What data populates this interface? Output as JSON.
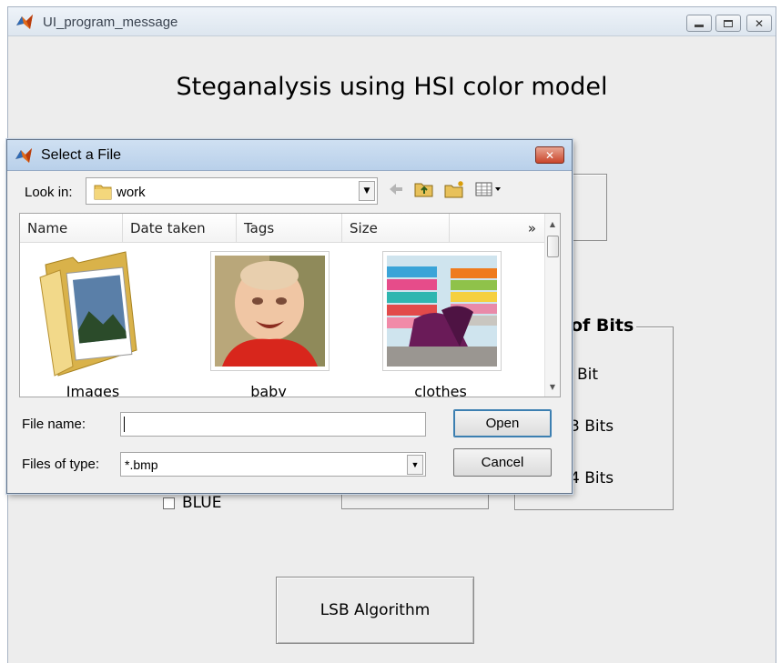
{
  "main_window": {
    "title": "UI_program_message",
    "heading": "Steganalysis using HSI color model",
    "bits_panel": {
      "title": "of Bits",
      "options": [
        "Bit",
        "3 Bits",
        "4 Bits"
      ]
    },
    "color_checkbox": {
      "label": "BLUE",
      "checked": false
    },
    "lsb_button": "LSB Algorithm"
  },
  "file_dialog": {
    "title": "Select a File",
    "look_in_label": "Look in:",
    "look_in_value": "work",
    "columns": [
      "Name",
      "Date taken",
      "Tags",
      "Size",
      "»"
    ],
    "items": [
      {
        "name": "Images",
        "kind": "folder"
      },
      {
        "name": "baby",
        "kind": "photo"
      },
      {
        "name": "clothes",
        "kind": "photo"
      }
    ],
    "file_name_label": "File name:",
    "file_name_value": "",
    "files_of_type_label": "Files of type:",
    "files_of_type_value": "*.bmp",
    "open_button": "Open",
    "cancel_button": "Cancel"
  },
  "icons": [
    "matlab-icon",
    "folder-icon",
    "back-arrow-icon",
    "up-folder-icon",
    "new-folder-icon",
    "view-menu-icon"
  ],
  "colors": {
    "window_bg": "#ededed",
    "dialog_title_bg": "#c5d9ef",
    "close_red": "#c9452b"
  }
}
